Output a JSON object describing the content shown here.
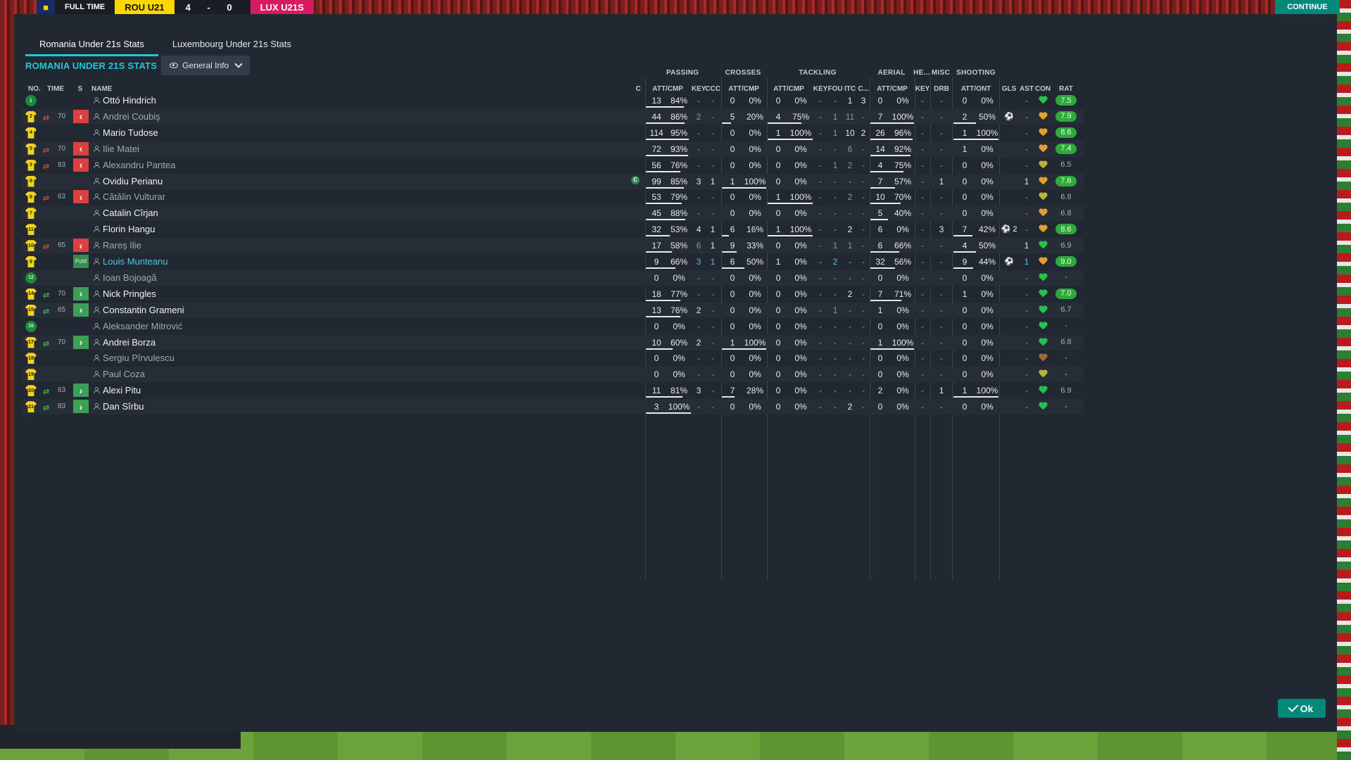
{
  "scoreboard": {
    "time": "FULL TIME",
    "home": "ROU U21",
    "score": "4 - 0",
    "away": "LUX U21S",
    "continue": "CONTINUE"
  },
  "tabs": [
    "Romania Under 21s Stats",
    "Luxembourg Under 21s Stats"
  ],
  "title": "ROMANIA UNDER 21S STATS",
  "view": "General Info",
  "ok_label": "Ok",
  "groups": {
    "passing": "PASSING",
    "crosses": "CROSSES",
    "tackling": "TACKLING",
    "aerial": "AERIAL",
    "headers": "HE...",
    "misc": "MISC",
    "shooting": "SHOOTING"
  },
  "columns": {
    "no": "NO.",
    "time": "TIME",
    "s": "S",
    "name": "NAME",
    "c": "C",
    "pass_att": "ATT/CMP",
    "key": "KEY",
    "ccc": "CCC",
    "cross_att": "ATT/CMP",
    "tack_att": "ATT/CMP",
    "tack_key": "KEY",
    "fou": "FOU",
    "itc": "ITC",
    "clr": "C...",
    "aer_att": "ATT/CMP",
    "he_key": "KEY",
    "drb": "DRB",
    "shot_att": "ATT/ONT",
    "gls": "GLS",
    "ast": "AST",
    "con": "CON",
    "rat": "RAT"
  },
  "colors": {
    "accent": "#25c5e0",
    "sub_off": "#d9403f",
    "sub_on": "#3e9e55",
    "rating_high": "#2faa3a",
    "con_green": "#27c24c",
    "con_amber": "#e0a030",
    "con_olive": "#b8b43a"
  },
  "players": [
    {
      "no": "1",
      "gk": true,
      "sub": "",
      "time": "",
      "name": "Ottó Hindrich",
      "cap": false,
      "p_a": "13",
      "p_p": "84%",
      "p_f": 0.84,
      "key": "-",
      "ccc": "-",
      "c_a": "0",
      "c_p": "0%",
      "c_f": 0,
      "t_a": "0",
      "t_p": "0%",
      "t_f": 0,
      "t_key": "-",
      "fou": "-",
      "itc": "1",
      "clr": "3",
      "a_a": "0",
      "a_p": "0%",
      "a_f": 0,
      "he": "-",
      "drb": "-",
      "s_a": "0",
      "s_p": "0%",
      "s_f": 0,
      "gls": "",
      "ast": "-",
      "con": "green",
      "rat": "7.5",
      "hi": true,
      "dim": false
    },
    {
      "no": "2",
      "gk": false,
      "sub": "off",
      "time": "70",
      "name": "Andrei Coubiş",
      "cap": false,
      "p_a": "44",
      "p_p": "86%",
      "p_f": 0.86,
      "key": "2",
      "ccc": "-",
      "c_a": "5",
      "c_p": "20%",
      "c_f": 0.2,
      "t_a": "4",
      "t_p": "75%",
      "t_f": 0.75,
      "t_key": "-",
      "fou": "1",
      "itc": "11",
      "clr": "-",
      "a_a": "7",
      "a_p": "100%",
      "a_f": 1,
      "he": "-",
      "drb": "-",
      "s_a": "2",
      "s_p": "50%",
      "s_f": 0.5,
      "gls": "ball",
      "ast": "-",
      "con": "amber",
      "rat": "7.9",
      "hi": true,
      "dim": true
    },
    {
      "no": "4",
      "gk": false,
      "sub": "",
      "time": "",
      "name": "Mario Tudose",
      "cap": false,
      "p_a": "114",
      "p_p": "95%",
      "p_f": 0.95,
      "key": "-",
      "ccc": "-",
      "c_a": "0",
      "c_p": "0%",
      "c_f": 0,
      "t_a": "1",
      "t_p": "100%",
      "t_f": 1,
      "t_key": "-",
      "fou": "1",
      "itc": "10",
      "clr": "2",
      "a_a": "26",
      "a_p": "96%",
      "a_f": 0.96,
      "he": "-",
      "drb": "-",
      "s_a": "1",
      "s_p": "100%",
      "s_f": 1,
      "gls": "",
      "ast": "-",
      "con": "amber",
      "rat": "8.6",
      "hi": true,
      "dim": false
    },
    {
      "no": "5",
      "gk": false,
      "sub": "off",
      "time": "70",
      "name": "Ilie Matei",
      "cap": false,
      "p_a": "72",
      "p_p": "93%",
      "p_f": 0.93,
      "key": "-",
      "ccc": "-",
      "c_a": "0",
      "c_p": "0%",
      "c_f": 0,
      "t_a": "0",
      "t_p": "0%",
      "t_f": 0,
      "t_key": "-",
      "fou": "-",
      "itc": "6",
      "clr": "-",
      "a_a": "14",
      "a_p": "92%",
      "a_f": 0.92,
      "he": "-",
      "drb": "-",
      "s_a": "1",
      "s_p": "0%",
      "s_f": 0,
      "gls": "",
      "ast": "-",
      "con": "amber",
      "rat": "7.4",
      "hi": true,
      "dim": true
    },
    {
      "no": "3",
      "gk": false,
      "sub": "off",
      "time": "83",
      "name": "Alexandru Pantea",
      "cap": false,
      "p_a": "56",
      "p_p": "76%",
      "p_f": 0.76,
      "key": "-",
      "ccc": "-",
      "c_a": "0",
      "c_p": "0%",
      "c_f": 0,
      "t_a": "0",
      "t_p": "0%",
      "t_f": 0,
      "t_key": "-",
      "fou": "1",
      "itc": "2",
      "clr": "-",
      "a_a": "4",
      "a_p": "75%",
      "a_f": 0.75,
      "he": "-",
      "drb": "-",
      "s_a": "0",
      "s_p": "0%",
      "s_f": 0,
      "gls": "",
      "ast": "-",
      "con": "olive",
      "rat": "6.5",
      "hi": false,
      "dim": true
    },
    {
      "no": "6",
      "gk": false,
      "sub": "",
      "time": "",
      "name": "Ovidiu Perianu",
      "cap": true,
      "p_a": "99",
      "p_p": "85%",
      "p_f": 0.85,
      "key": "3",
      "ccc": "1",
      "c_a": "1",
      "c_p": "100%",
      "c_f": 1,
      "t_a": "0",
      "t_p": "0%",
      "t_f": 0,
      "t_key": "-",
      "fou": "-",
      "itc": "-",
      "clr": "-",
      "a_a": "7",
      "a_p": "57%",
      "a_f": 0.57,
      "he": "-",
      "drb": "1",
      "s_a": "0",
      "s_p": "0%",
      "s_f": 0,
      "gls": "",
      "ast": "1",
      "con": "amber",
      "rat": "7.6",
      "hi": true,
      "dim": false
    },
    {
      "no": "8",
      "gk": false,
      "sub": "off",
      "time": "63",
      "name": "Cătălin Vulturar",
      "cap": false,
      "p_a": "53",
      "p_p": "79%",
      "p_f": 0.79,
      "key": "-",
      "ccc": "-",
      "c_a": "0",
      "c_p": "0%",
      "c_f": 0,
      "t_a": "1",
      "t_p": "100%",
      "t_f": 1,
      "t_key": "-",
      "fou": "-",
      "itc": "2",
      "clr": "-",
      "a_a": "10",
      "a_p": "70%",
      "a_f": 0.7,
      "he": "-",
      "drb": "-",
      "s_a": "0",
      "s_p": "0%",
      "s_f": 0,
      "gls": "",
      "ast": "-",
      "con": "olive",
      "rat": "6.8",
      "hi": false,
      "dim": true
    },
    {
      "no": "7",
      "gk": false,
      "sub": "",
      "time": "",
      "name": "Catalin Cîrjan",
      "cap": false,
      "p_a": "45",
      "p_p": "88%",
      "p_f": 0.88,
      "key": "-",
      "ccc": "-",
      "c_a": "0",
      "c_p": "0%",
      "c_f": 0,
      "t_a": "0",
      "t_p": "0%",
      "t_f": 0,
      "t_key": "-",
      "fou": "-",
      "itc": "-",
      "clr": "-",
      "a_a": "5",
      "a_p": "40%",
      "a_f": 0.4,
      "he": "-",
      "drb": "-",
      "s_a": "0",
      "s_p": "0%",
      "s_f": 0,
      "gls": "",
      "ast": "-",
      "con": "amber",
      "rat": "6.8",
      "hi": false,
      "dim": false
    },
    {
      "no": "11",
      "gk": false,
      "sub": "",
      "time": "",
      "name": "Florin Hangu",
      "cap": false,
      "p_a": "32",
      "p_p": "53%",
      "p_f": 0.53,
      "key": "4",
      "ccc": "1",
      "c_a": "6",
      "c_p": "16%",
      "c_f": 0.16,
      "t_a": "1",
      "t_p": "100%",
      "t_f": 1,
      "t_key": "-",
      "fou": "-",
      "itc": "2",
      "clr": "-",
      "a_a": "6",
      "a_p": "0%",
      "a_f": 0,
      "he": "-",
      "drb": "3",
      "s_a": "7",
      "s_p": "42%",
      "s_f": 0.42,
      "gls": "ball2",
      "ast": "-",
      "con": "amber",
      "rat": "8.6",
      "hi": true,
      "dim": false
    },
    {
      "no": "10",
      "gk": false,
      "sub": "off",
      "time": "65",
      "name": "Rareş Ilie",
      "cap": false,
      "p_a": "17",
      "p_p": "58%",
      "p_f": 0.58,
      "key": "6",
      "ccc": "1",
      "c_a": "9",
      "c_p": "33%",
      "c_f": 0.33,
      "t_a": "0",
      "t_p": "0%",
      "t_f": 0,
      "t_key": "-",
      "fou": "1",
      "itc": "1",
      "clr": "-",
      "a_a": "6",
      "a_p": "66%",
      "a_f": 0.66,
      "he": "-",
      "drb": "-",
      "s_a": "4",
      "s_p": "50%",
      "s_f": 0.5,
      "gls": "",
      "ast": "1",
      "con": "green",
      "rat": "6.9",
      "hi": false,
      "dim": true
    },
    {
      "no": "9",
      "gk": false,
      "sub": "pom",
      "time": "",
      "name": "Louis Munteanu",
      "cap": false,
      "p_a": "9",
      "p_p": "66%",
      "p_f": 0.66,
      "key": "3",
      "ccc": "1",
      "c_a": "6",
      "c_p": "50%",
      "c_f": 0.5,
      "t_a": "1",
      "t_p": "0%",
      "t_f": 0,
      "t_key": "-",
      "fou": "2",
      "itc": "-",
      "clr": "-",
      "a_a": "32",
      "a_p": "56%",
      "a_f": 0.56,
      "he": "-",
      "drb": "-",
      "s_a": "9",
      "s_p": "44%",
      "s_f": 0.44,
      "gls": "ball",
      "ast": "1",
      "con": "amber",
      "rat": "9.0",
      "hi": true,
      "dim": false
    },
    {
      "no": "12",
      "gk": true,
      "sub": "",
      "time": "",
      "name": "Ioan Bojoagă",
      "cap": false,
      "p_a": "0",
      "p_p": "0%",
      "p_f": 0,
      "key": "-",
      "ccc": "-",
      "c_a": "0",
      "c_p": "0%",
      "c_f": 0,
      "t_a": "0",
      "t_p": "0%",
      "t_f": 0,
      "t_key": "-",
      "fou": "-",
      "itc": "-",
      "clr": "-",
      "a_a": "0",
      "a_p": "0%",
      "a_f": 0,
      "he": "-",
      "drb": "-",
      "s_a": "0",
      "s_p": "0%",
      "s_f": 0,
      "gls": "",
      "ast": "-",
      "con": "green",
      "rat": "-",
      "hi": false,
      "dim": true
    },
    {
      "no": "14",
      "gk": false,
      "sub": "on",
      "time": "70",
      "name": "Nick Pringles",
      "cap": false,
      "p_a": "18",
      "p_p": "77%",
      "p_f": 0.77,
      "key": "-",
      "ccc": "-",
      "c_a": "0",
      "c_p": "0%",
      "c_f": 0,
      "t_a": "0",
      "t_p": "0%",
      "t_f": 0,
      "t_key": "-",
      "fou": "-",
      "itc": "2",
      "clr": "-",
      "a_a": "7",
      "a_p": "71%",
      "a_f": 0.71,
      "he": "-",
      "drb": "-",
      "s_a": "1",
      "s_p": "0%",
      "s_f": 0,
      "gls": "",
      "ast": "-",
      "con": "green",
      "rat": "7.0",
      "hi": true,
      "dim": false
    },
    {
      "no": "15",
      "gk": false,
      "sub": "on",
      "time": "65",
      "name": "Constantin Grameni",
      "cap": false,
      "p_a": "13",
      "p_p": "76%",
      "p_f": 0.76,
      "key": "2",
      "ccc": "-",
      "c_a": "0",
      "c_p": "0%",
      "c_f": 0,
      "t_a": "0",
      "t_p": "0%",
      "t_f": 0,
      "t_key": "-",
      "fou": "1",
      "itc": "-",
      "clr": "-",
      "a_a": "1",
      "a_p": "0%",
      "a_f": 0,
      "he": "-",
      "drb": "-",
      "s_a": "0",
      "s_p": "0%",
      "s_f": 0,
      "gls": "",
      "ast": "-",
      "con": "green",
      "rat": "6.7",
      "hi": false,
      "dim": false
    },
    {
      "no": "16",
      "gk": true,
      "sub": "",
      "time": "",
      "name": "Aleksander Mitrović",
      "cap": false,
      "p_a": "0",
      "p_p": "0%",
      "p_f": 0,
      "key": "-",
      "ccc": "-",
      "c_a": "0",
      "c_p": "0%",
      "c_f": 0,
      "t_a": "0",
      "t_p": "0%",
      "t_f": 0,
      "t_key": "-",
      "fou": "-",
      "itc": "-",
      "clr": "-",
      "a_a": "0",
      "a_p": "0%",
      "a_f": 0,
      "he": "-",
      "drb": "-",
      "s_a": "0",
      "s_p": "0%",
      "s_f": 0,
      "gls": "",
      "ast": "-",
      "con": "green",
      "rat": "-",
      "hi": false,
      "dim": true
    },
    {
      "no": "17",
      "gk": false,
      "sub": "on",
      "time": "70",
      "name": "Andrei Borza",
      "cap": false,
      "p_a": "10",
      "p_p": "60%",
      "p_f": 0.6,
      "key": "2",
      "ccc": "-",
      "c_a": "1",
      "c_p": "100%",
      "c_f": 1,
      "t_a": "0",
      "t_p": "0%",
      "t_f": 0,
      "t_key": "-",
      "fou": "-",
      "itc": "-",
      "clr": "-",
      "a_a": "1",
      "a_p": "100%",
      "a_f": 1,
      "he": "-",
      "drb": "-",
      "s_a": "0",
      "s_p": "0%",
      "s_f": 0,
      "gls": "",
      "ast": "-",
      "con": "green",
      "rat": "6.8",
      "hi": false,
      "dim": false
    },
    {
      "no": "18",
      "gk": false,
      "sub": "",
      "time": "",
      "name": "Sergiu Pîrvulescu",
      "cap": false,
      "p_a": "0",
      "p_p": "0%",
      "p_f": 0,
      "key": "-",
      "ccc": "-",
      "c_a": "0",
      "c_p": "0%",
      "c_f": 0,
      "t_a": "0",
      "t_p": "0%",
      "t_f": 0,
      "t_key": "-",
      "fou": "-",
      "itc": "-",
      "clr": "-",
      "a_a": "0",
      "a_p": "0%",
      "a_f": 0,
      "he": "-",
      "drb": "-",
      "s_a": "0",
      "s_p": "0%",
      "s_f": 0,
      "gls": "",
      "ast": "-",
      "con": "brown",
      "rat": "-",
      "hi": false,
      "dim": true
    },
    {
      "no": "19",
      "gk": false,
      "sub": "",
      "time": "",
      "name": "Paul Coza",
      "cap": false,
      "p_a": "0",
      "p_p": "0%",
      "p_f": 0,
      "key": "-",
      "ccc": "-",
      "c_a": "0",
      "c_p": "0%",
      "c_f": 0,
      "t_a": "0",
      "t_p": "0%",
      "t_f": 0,
      "t_key": "-",
      "fou": "-",
      "itc": "-",
      "clr": "-",
      "a_a": "0",
      "a_p": "0%",
      "a_f": 0,
      "he": "-",
      "drb": "-",
      "s_a": "0",
      "s_p": "0%",
      "s_f": 0,
      "gls": "",
      "ast": "-",
      "con": "olive",
      "rat": "-",
      "hi": false,
      "dim": true
    },
    {
      "no": "20",
      "gk": false,
      "sub": "on",
      "time": "63",
      "name": "Alexi Pitu",
      "cap": false,
      "p_a": "11",
      "p_p": "81%",
      "p_f": 0.81,
      "key": "3",
      "ccc": "-",
      "c_a": "7",
      "c_p": "28%",
      "c_f": 0.28,
      "t_a": "0",
      "t_p": "0%",
      "t_f": 0,
      "t_key": "-",
      "fou": "-",
      "itc": "-",
      "clr": "-",
      "a_a": "2",
      "a_p": "0%",
      "a_f": 0,
      "he": "-",
      "drb": "1",
      "s_a": "1",
      "s_p": "100%",
      "s_f": 1,
      "gls": "",
      "ast": "-",
      "con": "green",
      "rat": "6.9",
      "hi": false,
      "dim": false
    },
    {
      "no": "21",
      "gk": false,
      "sub": "on",
      "time": "83",
      "name": "Dan Sîrbu",
      "cap": false,
      "p_a": "3",
      "p_p": "100%",
      "p_f": 1,
      "key": "-",
      "ccc": "-",
      "c_a": "0",
      "c_p": "0%",
      "c_f": 0,
      "t_a": "0",
      "t_p": "0%",
      "t_f": 0,
      "t_key": "-",
      "fou": "-",
      "itc": "2",
      "clr": "-",
      "a_a": "0",
      "a_p": "0%",
      "a_f": 0,
      "he": "-",
      "drb": "-",
      "s_a": "0",
      "s_p": "0%",
      "s_f": 0,
      "gls": "",
      "ast": "-",
      "con": "green",
      "rat": "-",
      "hi": false,
      "dim": false
    }
  ]
}
